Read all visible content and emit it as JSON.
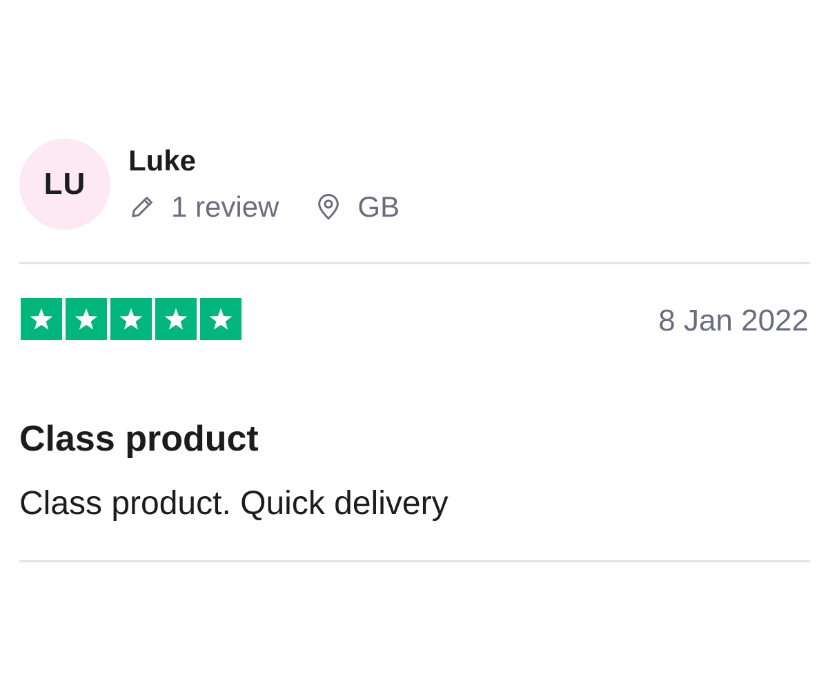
{
  "reviewer": {
    "initials": "LU",
    "name": "Luke",
    "review_count": "1 review",
    "country": "GB",
    "avatar_color": "#fde9f1"
  },
  "icons": {
    "review_count": "pencil-icon",
    "country": "location-pin-icon",
    "star": "star-icon"
  },
  "rating": {
    "stars": 5,
    "max": 5,
    "color": "#00b67a"
  },
  "review": {
    "date": "8 Jan 2022",
    "title": "Class product",
    "body": "Class product. Quick delivery"
  },
  "colors": {
    "meta_text": "#6b6c80",
    "divider": "#e2e2ea",
    "text": "#1c1c1c"
  }
}
